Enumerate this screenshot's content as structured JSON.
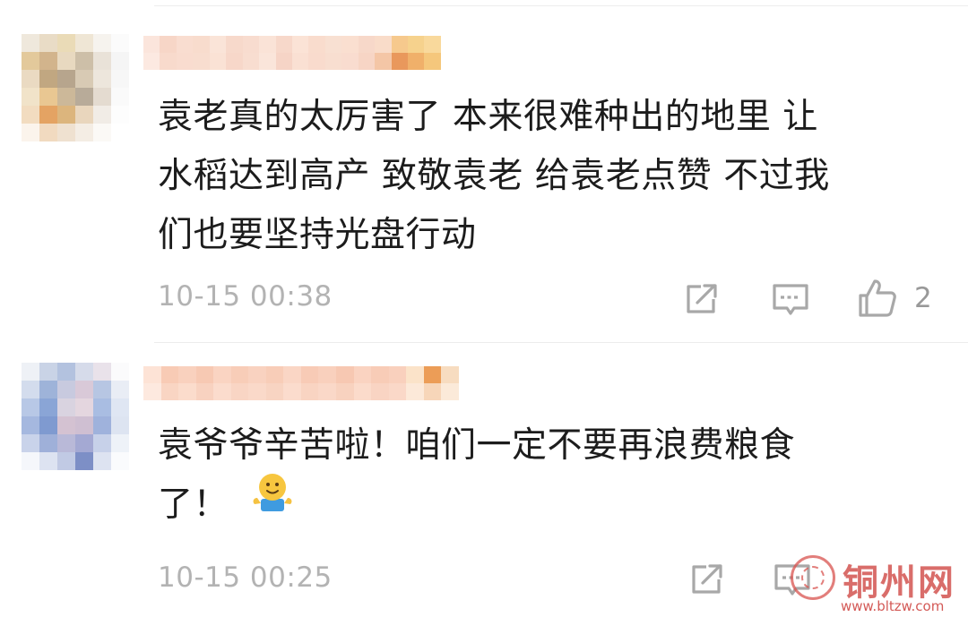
{
  "comments": [
    {
      "text": "袁老真的太厉害了 本来很难种出的地里 让\n水稻达到高产 致敬袁老 给袁老点赞 不过我\n们也要坚持光盘行动",
      "time": "10-15 00:38",
      "like_count": "2",
      "avatar_icon": "pixelated-avatar",
      "username_obscured": true,
      "actions": [
        "share-icon",
        "reply-icon",
        "thumbs-up-icon"
      ],
      "avatar_colors": [
        "#efe8dc",
        "#e9dcc6",
        "#eadbb7",
        "#efe6d5",
        "#f6f3ee",
        "#fbfbfb",
        "#e3c99b",
        "#d2b48c",
        "#e8d9c0",
        "#cdbfa8",
        "#e9e2d8",
        "#f5f5f5",
        "#eadac2",
        "#c1a781",
        "#b7a58d",
        "#d8cab4",
        "#ede6dc",
        "#f7f7f7",
        "#f1e3c9",
        "#e9c792",
        "#ccb899",
        "#b8ab99",
        "#e4dbd0",
        "#fafafa",
        "#f2dcc0",
        "#e4a363",
        "#dcb57d",
        "#e9d6bd",
        "#f1ece6",
        "#fdfdfd",
        "#fbf4ec",
        "#f1dac0",
        "#efe1d0",
        "#f4ede4",
        "#fbf9f6",
        "#ffffff"
      ],
      "username_colors": [
        "#fbe5dc",
        "#f7d6c7",
        "#f9ddd0",
        "#f8dccd",
        "#fae4d8",
        "#f7d9cb",
        "#f8dccf",
        "#fae3d7",
        "#f7d8ca",
        "#fbe3d6",
        "#f9dccd",
        "#f8e0d2",
        "#fadfd0",
        "#f7d8c9",
        "#f9dcc9",
        "#f6c98d",
        "#f6d28d",
        "#f9d99c",
        "#fce9e1",
        "#f8dacc",
        "#f9dccf",
        "#f8ddcf",
        "#fae2d5",
        "#f7d7c9",
        "#f8ddd0",
        "#fae5da",
        "#f6d4c6",
        "#fae0d3",
        "#f9dbcd",
        "#f8ded0",
        "#f9dccf",
        "#f7d5c5",
        "#f4c6a6",
        "#e9985c",
        "#f0b06a",
        "#f5c77c"
      ]
    },
    {
      "text": "袁爷爷辛苦啦！咱们一定不要再浪费粮食\n了！",
      "time": "10-15 00:25",
      "emoji_icon": "smiling-face-emoji-icon",
      "avatar_icon": "pixelated-avatar",
      "username_obscured": true,
      "actions": [
        "share-icon",
        "reply-icon"
      ],
      "avatar_colors": [
        "#eef1f6",
        "#c9d3e6",
        "#b3c2df",
        "#d6dbea",
        "#e9e2ea",
        "#fbfbfc",
        "#d3dced",
        "#9eb3d9",
        "#c8cadf",
        "#d9c9d8",
        "#b7c6e3",
        "#e9edf5",
        "#b8c8e6",
        "#8aa5d6",
        "#d9d3e0",
        "#e4d6df",
        "#a9bde2",
        "#dfe6f3",
        "#a5b8df",
        "#7f9ad0",
        "#d4c2d2",
        "#cfbfd2",
        "#9fb2dc",
        "#dde4f1",
        "#c9d3ea",
        "#9fb0d9",
        "#b9b9d8",
        "#a4a9d3",
        "#c7d1e9",
        "#eef2f8",
        "#f5f7fb",
        "#dde3f1",
        "#c1cae4",
        "#7d8fc6",
        "#dde3f1",
        "#fafbfd"
      ],
      "username_colors": [
        "#fde3d6",
        "#f8cbb5",
        "#f9d1be",
        "#f7c9b3",
        "#fad4c2",
        "#f8cdb8",
        "#f9d2c0",
        "#f8cdb8",
        "#fad6c5",
        "#f8cbb6",
        "#f9d0bd",
        "#f7c8b2",
        "#fad3c1",
        "#f8ccb7",
        "#f9d0bd",
        "#fbe3c9",
        "#ec9d57",
        "#f7dcc0",
        "#fde9df",
        "#f9d5c3",
        "#fbdccc",
        "#f8d2c0",
        "#fbdccd",
        "#f9d5c4",
        "#fad9c9",
        "#f8d4c2",
        "#fbdccd",
        "#f9d4c2",
        "#fad8c8",
        "#f8d2bf",
        "#fbdbcb",
        "#f9d4c3",
        "#fad8c8",
        "#fce9d9",
        "#f7d6b9",
        "#fbead9"
      ]
    }
  ],
  "watermark": {
    "name": "铜州网",
    "url": "www.bltzw.com",
    "seal_icon": "red-seal-logo-icon",
    "color": "#c9302c"
  }
}
